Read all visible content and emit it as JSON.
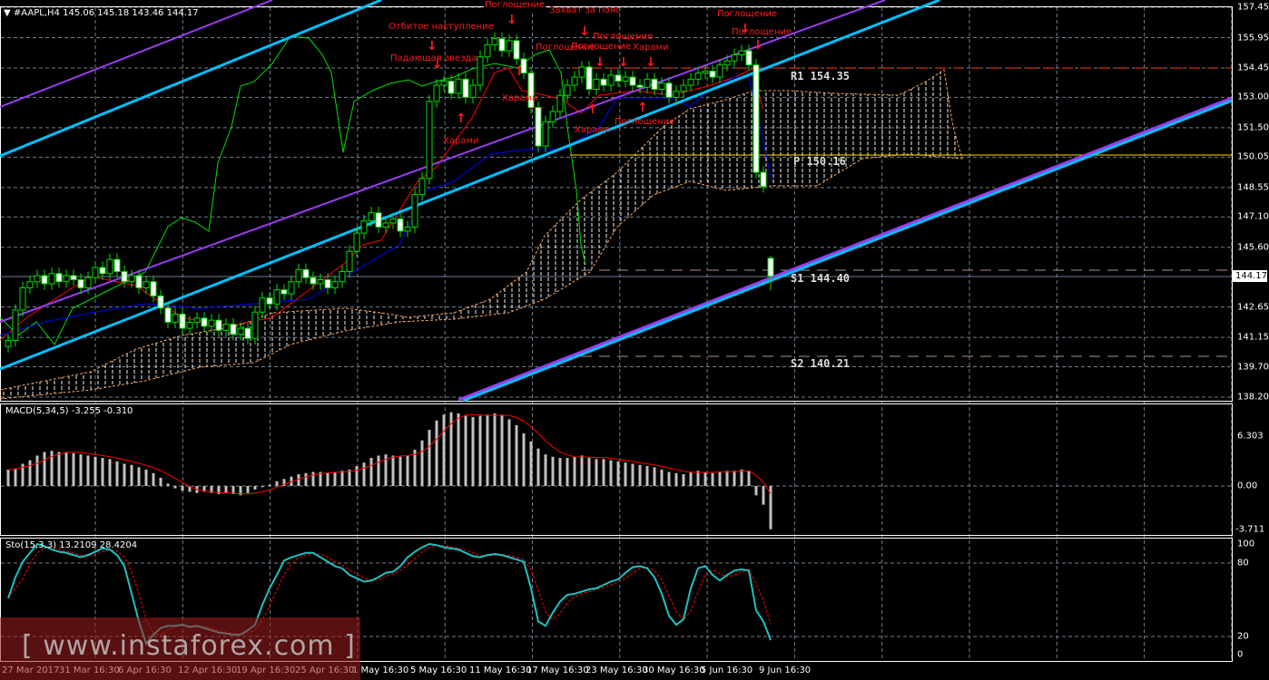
{
  "header": {
    "symbol": "#AAPL,H4",
    "ohlc_text": "145.06 145.18 143.46 144.17"
  },
  "price_axis": {
    "ticks": [
      157.45,
      155.95,
      154.45,
      153.0,
      151.5,
      150.05,
      148.55,
      147.1,
      145.6,
      142.65,
      141.15,
      139.7,
      138.2
    ],
    "current_price": "144.17"
  },
  "macd_panel": {
    "title": "MACD(5,34,5) -3.255 -0.310",
    "ticks": [
      "6.303",
      "0.00",
      "-3.711"
    ]
  },
  "sto_panel": {
    "title": "Sto(15,3,3) 13.2109 28.4204",
    "ticks": [
      "100",
      "80",
      "20",
      "0"
    ]
  },
  "time_axis": [
    "27 Mar 2017",
    "31 Mar 16:30",
    "6 Apr 16:30",
    "12 Apr 16:30",
    "19 Apr 16:30",
    "25 Apr 16:30",
    "1 May 16:30",
    "5 May 16:30",
    "11 May 16:30",
    "17 May 16:30",
    "23 May 16:30",
    "30 May 16:30",
    "5 Jun 16:30",
    "9 Jun 16:30"
  ],
  "pivots": {
    "r1": "R1 154.35",
    "p": "P 150.16",
    "s1": "S1 144.40",
    "s2": "S2 140.21"
  },
  "patterns": [
    "Поглощение",
    "Захват за пояс",
    "Отбитое наступление",
    "Падающая звезда",
    "Харами",
    "Харами",
    "Поглощение",
    "Поглощение",
    "Поглощение",
    "Харами",
    "Харами",
    "Поглощение",
    "Поглощение",
    "Поглощение"
  ],
  "watermark": "[ www.instaforex.com ]",
  "colors": {
    "background": "#000000",
    "candle": "#00e000",
    "macd_hist": "#c0c0c0",
    "signal": "#ff0000",
    "sto_main": "#20c0c0",
    "channel_cyan": "#00bfff",
    "channel_purple": "#9a3cf0",
    "pattern_text": "#ff1a1a"
  },
  "chart_data": {
    "type": "candlestick",
    "title": "#AAPL,H4",
    "ylim": [
      138.2,
      157.45
    ],
    "last_bar": {
      "open": 145.06,
      "high": 145.18,
      "low": 143.46,
      "close": 144.17
    },
    "close": [
      141.0,
      142.5,
      143.6,
      143.9,
      144.2,
      143.8,
      144.3,
      143.9,
      144.2,
      144.0,
      143.6,
      144.1,
      144.6,
      144.3,
      145.0,
      144.4,
      143.9,
      144.2,
      143.6,
      143.9,
      143.2,
      142.6,
      141.9,
      142.3,
      141.6,
      141.9,
      142.1,
      141.7,
      142.0,
      141.5,
      141.8,
      141.3,
      141.6,
      141.1,
      142.4,
      143.1,
      142.8,
      143.5,
      143.3,
      143.9,
      144.5,
      144.1,
      143.8,
      144.0,
      143.6,
      143.9,
      144.4,
      145.4,
      146.3,
      146.9,
      147.3,
      146.6,
      146.8,
      147.0,
      146.4,
      146.6,
      148.2,
      149.0,
      152.8,
      153.6,
      153.8,
      153.2,
      153.9,
      153.0,
      153.6,
      155.0,
      155.6,
      155.9,
      155.3,
      155.8,
      154.9,
      154.2,
      152.5,
      150.6,
      151.8,
      152.3,
      153.1,
      153.6,
      154.0,
      154.5,
      153.4,
      153.9,
      153.6,
      154.1,
      153.8,
      154.0,
      153.6,
      153.5,
      153.9,
      153.4,
      153.7,
      153.0,
      153.3,
      153.6,
      153.9,
      154.2,
      154.3,
      154.0,
      154.6,
      154.8,
      155.1,
      155.3,
      154.6,
      149.3,
      148.6,
      144.17
    ],
    "macd": [
      1.4,
      1.5,
      1.9,
      2.2,
      2.6,
      2.9,
      3.0,
      2.9,
      2.9,
      2.8,
      2.7,
      2.6,
      2.5,
      2.4,
      2.3,
      2.1,
      1.9,
      1.8,
      1.6,
      1.4,
      1.1,
      0.7,
      0.2,
      -0.2,
      -0.4,
      -0.5,
      -0.6,
      -0.5,
      -0.6,
      -0.7,
      -0.6,
      -0.7,
      -0.8,
      -0.6,
      -0.3,
      -0.1,
      0.1,
      0.4,
      0.6,
      0.8,
      1.0,
      1.1,
      1.2,
      1.2,
      1.1,
      1.2,
      1.3,
      1.4,
      1.7,
      2.0,
      2.4,
      2.6,
      2.7,
      2.6,
      2.5,
      2.6,
      3.1,
      3.9,
      4.8,
      5.6,
      6.1,
      6.3,
      6.2,
      6.0,
      5.9,
      6.0,
      6.1,
      6.2,
      6.1,
      5.7,
      5.2,
      4.5,
      3.8,
      3.2,
      2.7,
      2.5,
      2.4,
      2.4,
      2.5,
      2.6,
      2.4,
      2.3,
      2.3,
      2.2,
      2.1,
      2.0,
      1.9,
      1.8,
      1.7,
      1.6,
      1.4,
      1.2,
      1.1,
      1.0,
      1.2,
      1.3,
      1.2,
      1.1,
      1.2,
      1.3,
      1.3,
      1.4,
      1.3,
      -0.8,
      -1.6,
      -3.7
    ],
    "stochastic": [
      51,
      70,
      84,
      92,
      100,
      98,
      95,
      93,
      92,
      90,
      88,
      90,
      93,
      96,
      95,
      90,
      80,
      55,
      30,
      10,
      18,
      24,
      26,
      26,
      27,
      25,
      26,
      24,
      22,
      20,
      19,
      18,
      18,
      22,
      27,
      45,
      60,
      72,
      85,
      88,
      90,
      92,
      92,
      88,
      84,
      80,
      78,
      72,
      69,
      66,
      67,
      70,
      74,
      75,
      80,
      88,
      93,
      97,
      100,
      99,
      97,
      96,
      95,
      92,
      89,
      88,
      90,
      91,
      90,
      88,
      86,
      84,
      60,
      30,
      26,
      38,
      48,
      54,
      55,
      57,
      59,
      60,
      63,
      66,
      68,
      74,
      79,
      80,
      78,
      70,
      55,
      35,
      27,
      32,
      60,
      78,
      80,
      72,
      67,
      72,
      76,
      77,
      76,
      40,
      30,
      13
    ],
    "pivot_levels": {
      "R1": 154.35,
      "P": 150.16,
      "S1": 144.4,
      "S2": 140.21
    }
  }
}
